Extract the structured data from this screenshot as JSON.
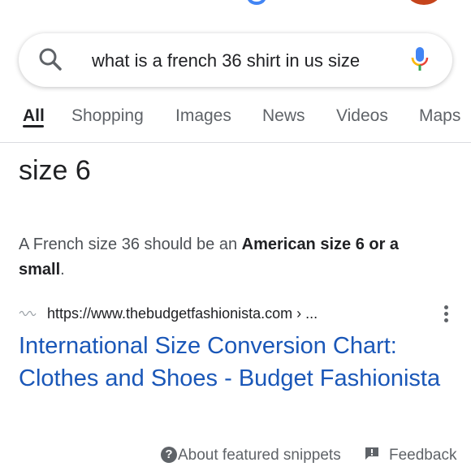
{
  "search": {
    "query": "what is a french 36 shirt in us size"
  },
  "tabs": [
    {
      "label": "All",
      "active": true
    },
    {
      "label": "Shopping"
    },
    {
      "label": "Images"
    },
    {
      "label": "News"
    },
    {
      "label": "Videos"
    },
    {
      "label": "Maps"
    }
  ],
  "featured_snippet": {
    "answer": "size 6",
    "text_before": "A French size 36 should be an ",
    "text_bold": "American size 6 or a small",
    "text_after": ".",
    "source_url": "https://www.thebudgetfashionista.com › ...",
    "title": "International Size Conversion Chart: Clothes and Shoes - Budget Fashionista"
  },
  "footer": {
    "help_symbol": "?",
    "about_label": "About featured snippets",
    "feedback_label": "Feedback"
  },
  "colors": {
    "link_blue": "#1a57b8",
    "text": "#202124",
    "secondary": "#5f6368",
    "avatar": "#c5441c"
  },
  "icons": [
    "search-icon",
    "mic-icon",
    "kebab-menu-icon",
    "help-icon",
    "feedback-icon",
    "favicon"
  ]
}
